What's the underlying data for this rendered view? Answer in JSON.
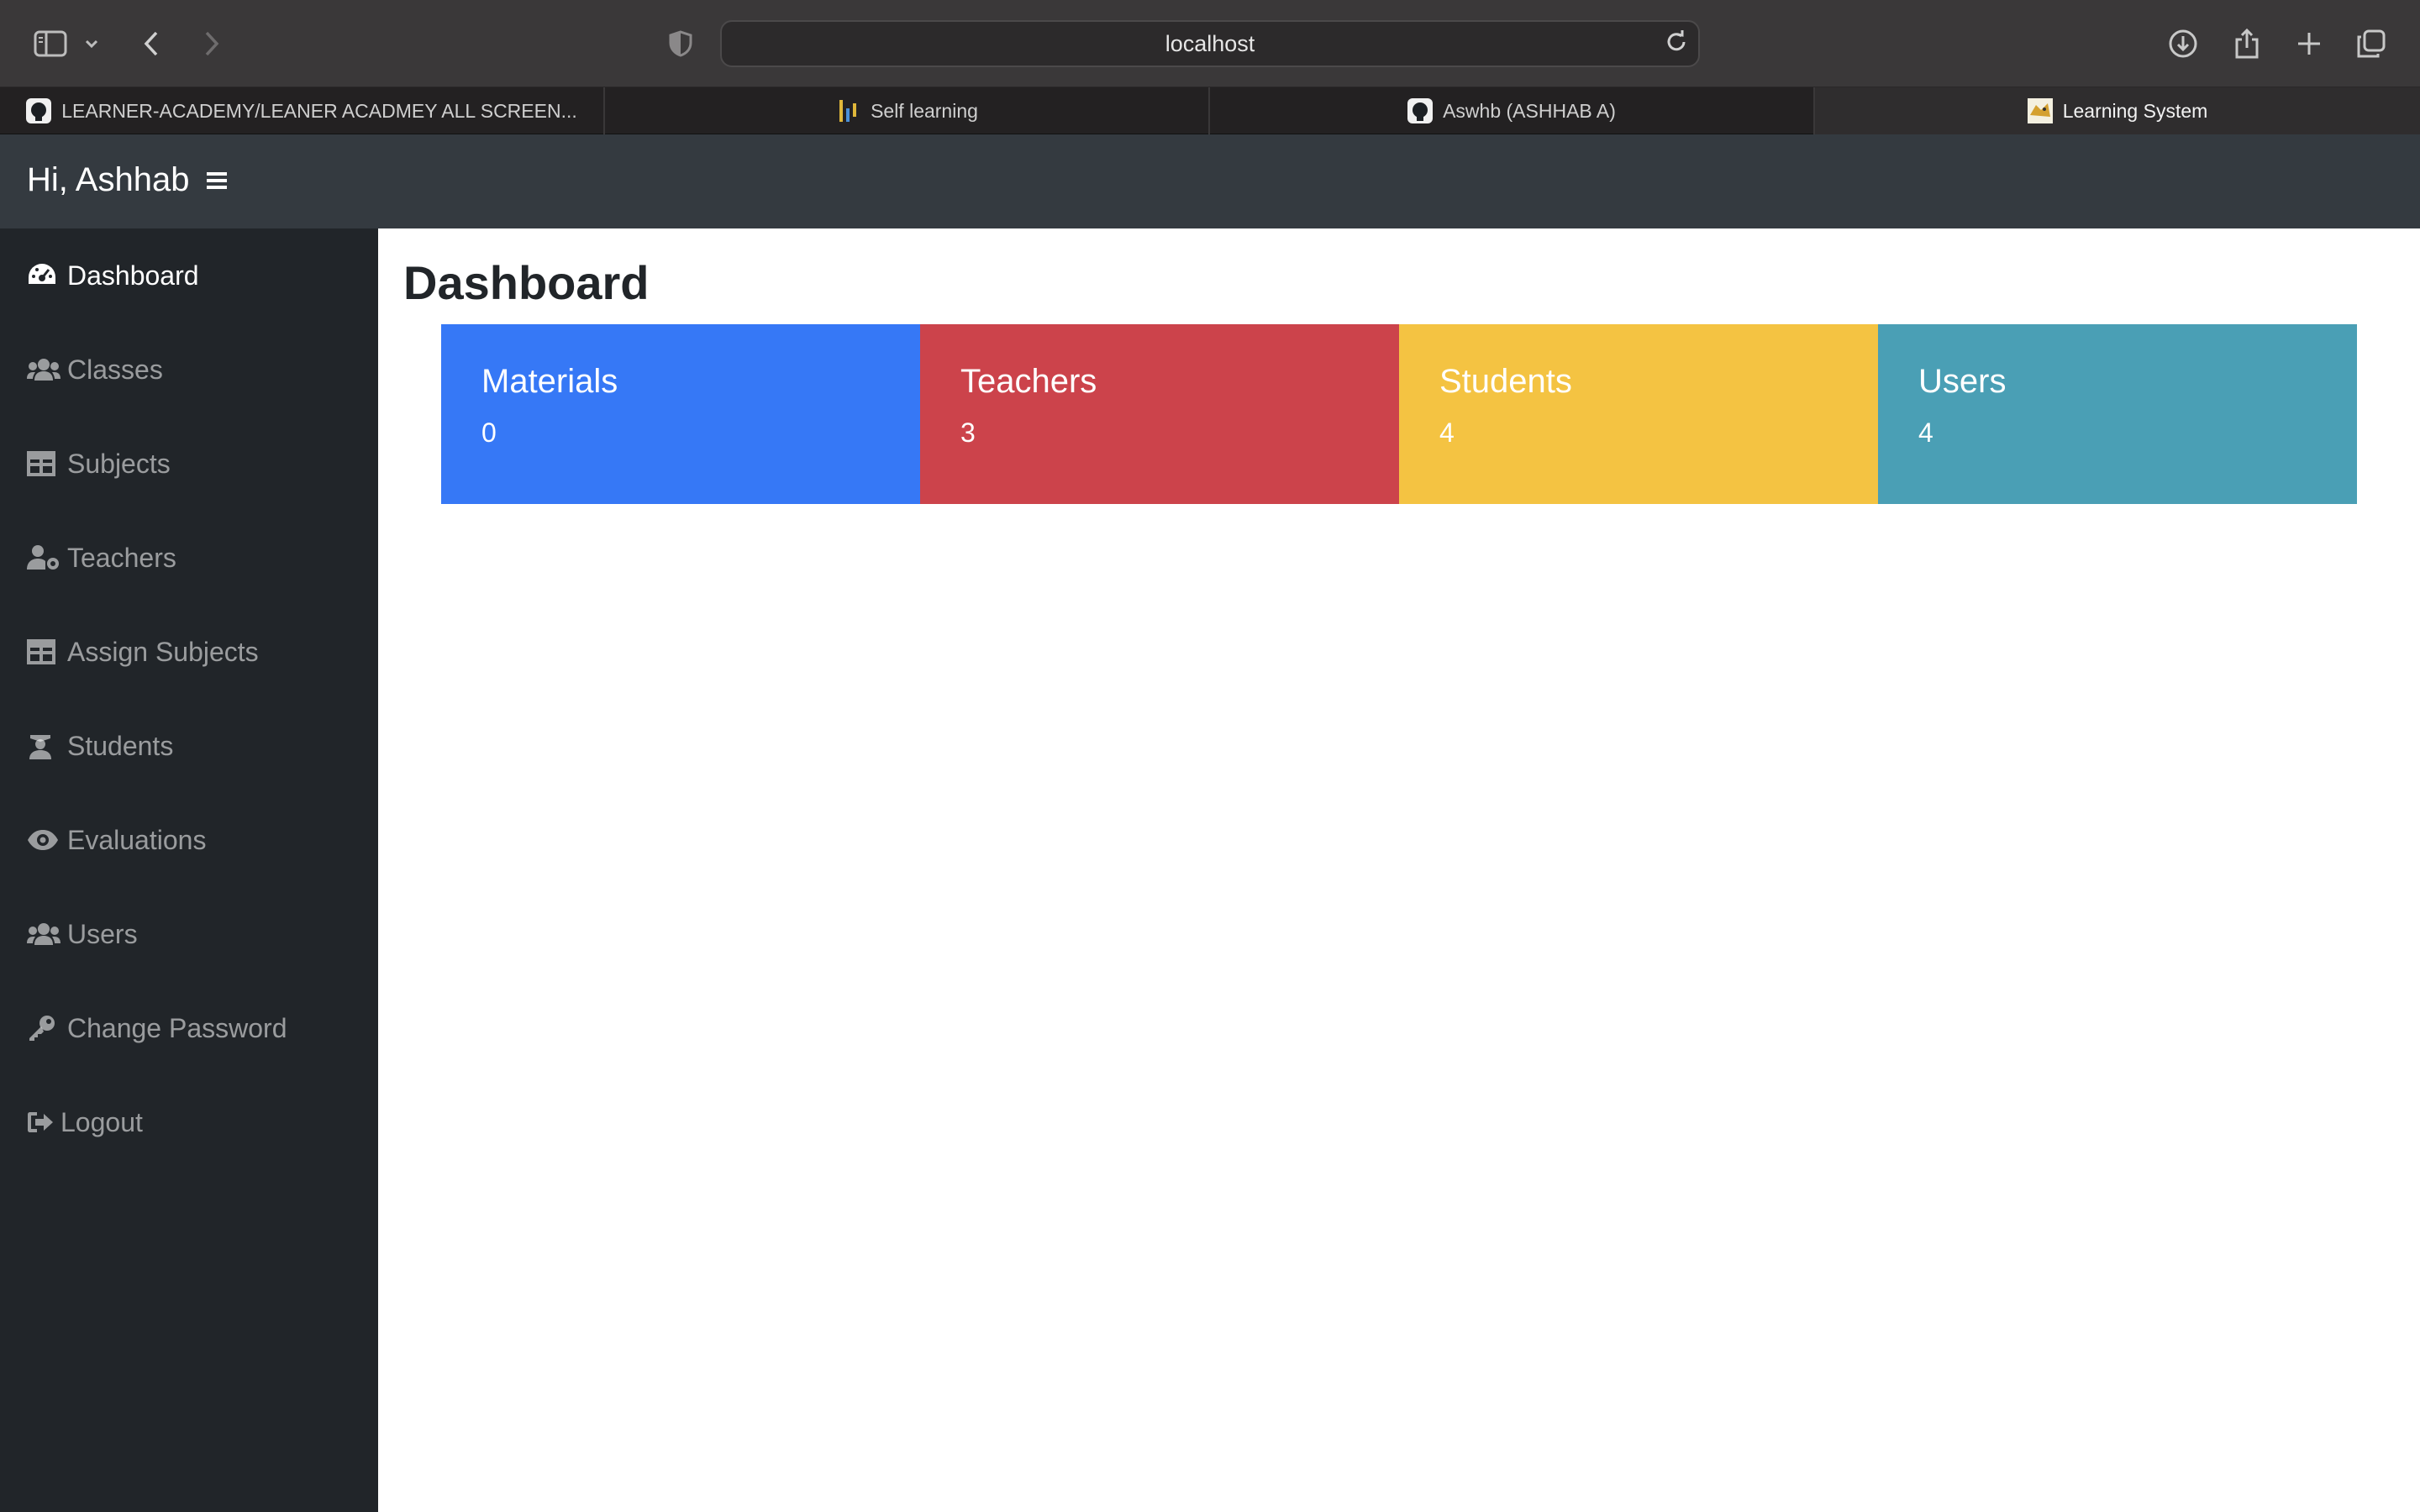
{
  "browser": {
    "url": "localhost",
    "tabs": [
      {
        "label": "LEARNER-ACADEMY/LEANER ACADMEY ALL SCREEN...",
        "icon": "github-icon",
        "active": false
      },
      {
        "label": "Self learning",
        "icon": "bar-logo-icon",
        "active": false
      },
      {
        "label": "Aswhb (ASHHAB A)",
        "icon": "github-icon",
        "active": false
      },
      {
        "label": "Learning System",
        "icon": "tomcat-icon",
        "active": true
      }
    ]
  },
  "header": {
    "greeting": "Hi, Ashhab"
  },
  "sidebar": {
    "items": [
      {
        "label": "Dashboard",
        "icon": "dashboard-icon",
        "active": true
      },
      {
        "label": "Classes",
        "icon": "users-group-icon",
        "active": false
      },
      {
        "label": "Subjects",
        "icon": "table-icon",
        "active": false
      },
      {
        "label": "Teachers",
        "icon": "user-gear-icon",
        "active": false
      },
      {
        "label": "Assign Subjects",
        "icon": "table-icon",
        "active": false
      },
      {
        "label": "Students",
        "icon": "graduate-icon",
        "active": false
      },
      {
        "label": "Evaluations",
        "icon": "eye-icon",
        "active": false
      },
      {
        "label": "Users",
        "icon": "users-group-icon",
        "active": false
      },
      {
        "label": "Change Password",
        "icon": "key-icon",
        "active": false
      },
      {
        "label": "Logout",
        "icon": "sign-out-icon",
        "active": false
      }
    ]
  },
  "main": {
    "title": "Dashboard",
    "cards": [
      {
        "title": "Materials",
        "count": "0",
        "color": "#3678f6"
      },
      {
        "title": "Teachers",
        "count": "3",
        "color": "#cc434b"
      },
      {
        "title": "Students",
        "count": "4",
        "color": "#f4c342"
      },
      {
        "title": "Users",
        "count": "4",
        "color": "#4a9fb5"
      }
    ]
  }
}
